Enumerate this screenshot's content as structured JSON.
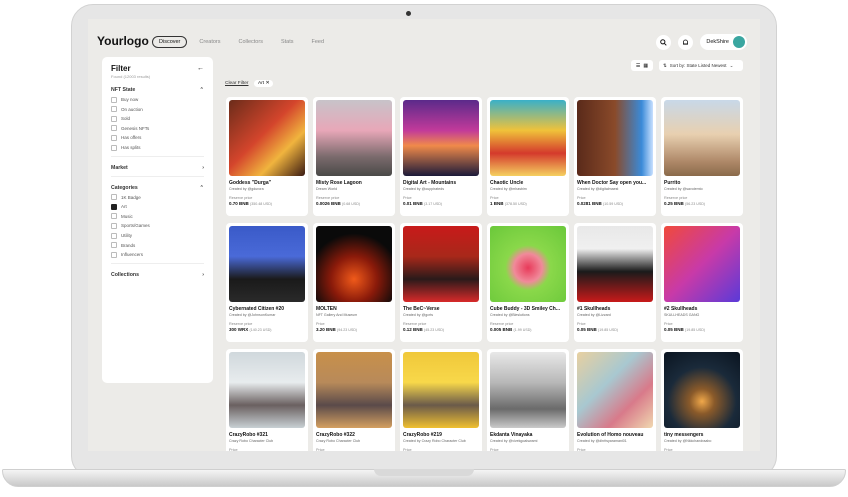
{
  "header": {
    "logo": "Yourlogo",
    "nav": [
      "Discover",
      "Creators",
      "Collectors",
      "Stats",
      "Feed"
    ],
    "user": "DekShire"
  },
  "filter": {
    "title": "Filter",
    "results": "Found (12003 results)",
    "nft_state": "NFT State",
    "states": [
      "Buy now",
      "On auction",
      "Sold",
      "Genesis NFTs",
      "Has offers",
      "Has splits"
    ],
    "market": "Market",
    "categories": "Categories",
    "category_items": [
      "1K Badge",
      "Art",
      "Music",
      "Sports/Games",
      "Utility",
      "Brands",
      "Influencers"
    ],
    "collections": "Collections"
  },
  "toolbar": {
    "clear": "Clear Filter",
    "chip": "Art ✕",
    "sort": "Sort by: State Listed Newest"
  },
  "cards": [
    {
      "title": "Goddess \"Durga\"",
      "by": "Created by @gdurora",
      "label": "Reserve price",
      "price": "0.70 BNB",
      "usd": "(350.48 USD)",
      "g": "linear-gradient(135deg,#6b2c1a,#d4452c 45%,#f0b43e 70%,#3a1a12)"
    },
    {
      "title": "Misty Rose Lagoon",
      "by": "Dream World",
      "label": "Reserve price",
      "price": "0.0026 BNB",
      "usd": "(0.68 USD)",
      "g": "linear-gradient(180deg,#c7c3c9,#e8a7b8 40%,#7a6a6c 75%,#4a4a48)"
    },
    {
      "title": "Digital Art - Mountains",
      "by": "Created by @ouppirateds",
      "label": "Price",
      "price": "0.01 BNB",
      "usd": "(3.17 USD)",
      "g": "linear-gradient(180deg,#5b2a8a,#c23a9a 40%,#f08a4a 60%,#1b1a3a)"
    },
    {
      "title": "Chaotic Uncle",
      "by": "Created by @mhasbim",
      "label": "Price",
      "price": "1 BNB",
      "usd": "(378.50 USD)",
      "g": "linear-gradient(180deg,#3ab0c8,#f0c23a 40%,#d43a2c 70%,#f5d060)"
    },
    {
      "title": "When Doctor Say open you...",
      "by": "Created by @digitalmaest",
      "label": "Price",
      "price": "0.0281 BNB",
      "usd": "(10.59 USD)",
      "g": "linear-gradient(90deg,#5a2a1a,#8a4a2a 50%,#3a8ad8 85%,#c8e0ff)"
    },
    {
      "title": "Purrito",
      "by": "Created by @savoiemto",
      "label": "Reserve price",
      "price": "0.25 BNB",
      "usd": "(56.23 USD)",
      "g": "linear-gradient(180deg,#c8d8e8,#e8d0b0 45%,#b08a6a 80%,#8a6a4a)"
    },
    {
      "title": "Cybernated Citizen #20",
      "by": "Created by @JohnsonKumar",
      "label": "Reserve price",
      "price": "300 WRX",
      "usd": "(140.23 USD)",
      "g": "linear-gradient(180deg,#3a5ac8,#4a6ad8 40%,#1a1a1a 70%,#2a2a2a)"
    },
    {
      "title": "MOLTEN",
      "by": "NFT Gallery And Museum",
      "label": "Price",
      "price": "3.20 BNB",
      "usd": "(94.23 USD)",
      "g": "radial-gradient(circle at 50% 70%,#f05a1a,#8a1a0a 35%,#0a0a0a 70%)"
    },
    {
      "title": "The BeC~Verse",
      "by": "Created by @gcrts",
      "label": "Reserve price",
      "price": "0.12 BNB",
      "usd": "(45.23 USD)",
      "g": "linear-gradient(180deg,#c81a1a,#a8281a 40%,#2a1a1a 70%,#d82a2a)"
    },
    {
      "title": "Cube Buddy - 3D Smiley Ch...",
      "by": "Created by @Bleslutions",
      "label": "Reserve price",
      "price": "0.005 BNB",
      "usd": "(1.99 USD)",
      "g": "radial-gradient(circle at 50% 55%,#e83a5a,#f08a9a 25%,#8ad84a 40%,#6ac83a)"
    },
    {
      "title": "#1 Skullheads",
      "by": "Created by @Lizzard",
      "label": "Price",
      "price": "0.05 BNB",
      "usd": "(19.85 USD)",
      "g": "linear-gradient(180deg,#e8e8e8,#f0f0f0 30%,#1a1a1a 60%,#c81a1a)"
    },
    {
      "title": "#2 Skullheads",
      "by": "SKULLHEADS GANG",
      "label": "Price",
      "price": "0.05 BNB",
      "usd": "(19.85 USD)",
      "g": "linear-gradient(135deg,#f04a3a,#c83aa8 50%,#5a3ad8)"
    },
    {
      "title": "CrazyRobo #321",
      "by": "Crazy Robo Character Club",
      "label": "Price",
      "price": "",
      "usd": "",
      "g": "linear-gradient(180deg,#d0d8dc,#e8ecee 40%,#6a6060 70%,#c8d0d4)"
    },
    {
      "title": "CrazyRobo #322",
      "by": "Crazy Robo Character Club",
      "label": "Price",
      "price": "",
      "usd": "",
      "g": "linear-gradient(180deg,#c8904a,#b88a5a 40%,#5a4a4a 70%,#d4a060)"
    },
    {
      "title": "CrazyRobo #219",
      "by": "Created by Crazy Robo Character Club",
      "label": "Price",
      "price": "",
      "usd": "",
      "g": "linear-gradient(180deg,#f0c83a,#f8d84a 40%,#6a5a4a 70%,#f0c030)"
    },
    {
      "title": "Ekdanta Vinayaka",
      "by": "Created by @vivekgoalswami",
      "label": "Price",
      "price": "",
      "usd": "",
      "g": "linear-gradient(180deg,#e8e8e8,#b8b8b8 40%,#6a6a6a 75%,#cacaca)"
    },
    {
      "title": "Evolution of Homo nouveau",
      "by": "Created by @dhritsyaramani01",
      "label": "Price",
      "price": "",
      "usd": "",
      "g": "linear-gradient(135deg,#e8d0a0,#a8c8d0 40%,#d87a8a 70%,#f0d8b0)"
    },
    {
      "title": "tiny messengers",
      "by": "Created by @Nkkchandraabo",
      "label": "Price",
      "price": "",
      "usd": "",
      "g": "radial-gradient(circle at 50% 65%,#f0a84a,#8a5a2a 20%,#1a2a3a 55%,#0a1420)"
    }
  ]
}
